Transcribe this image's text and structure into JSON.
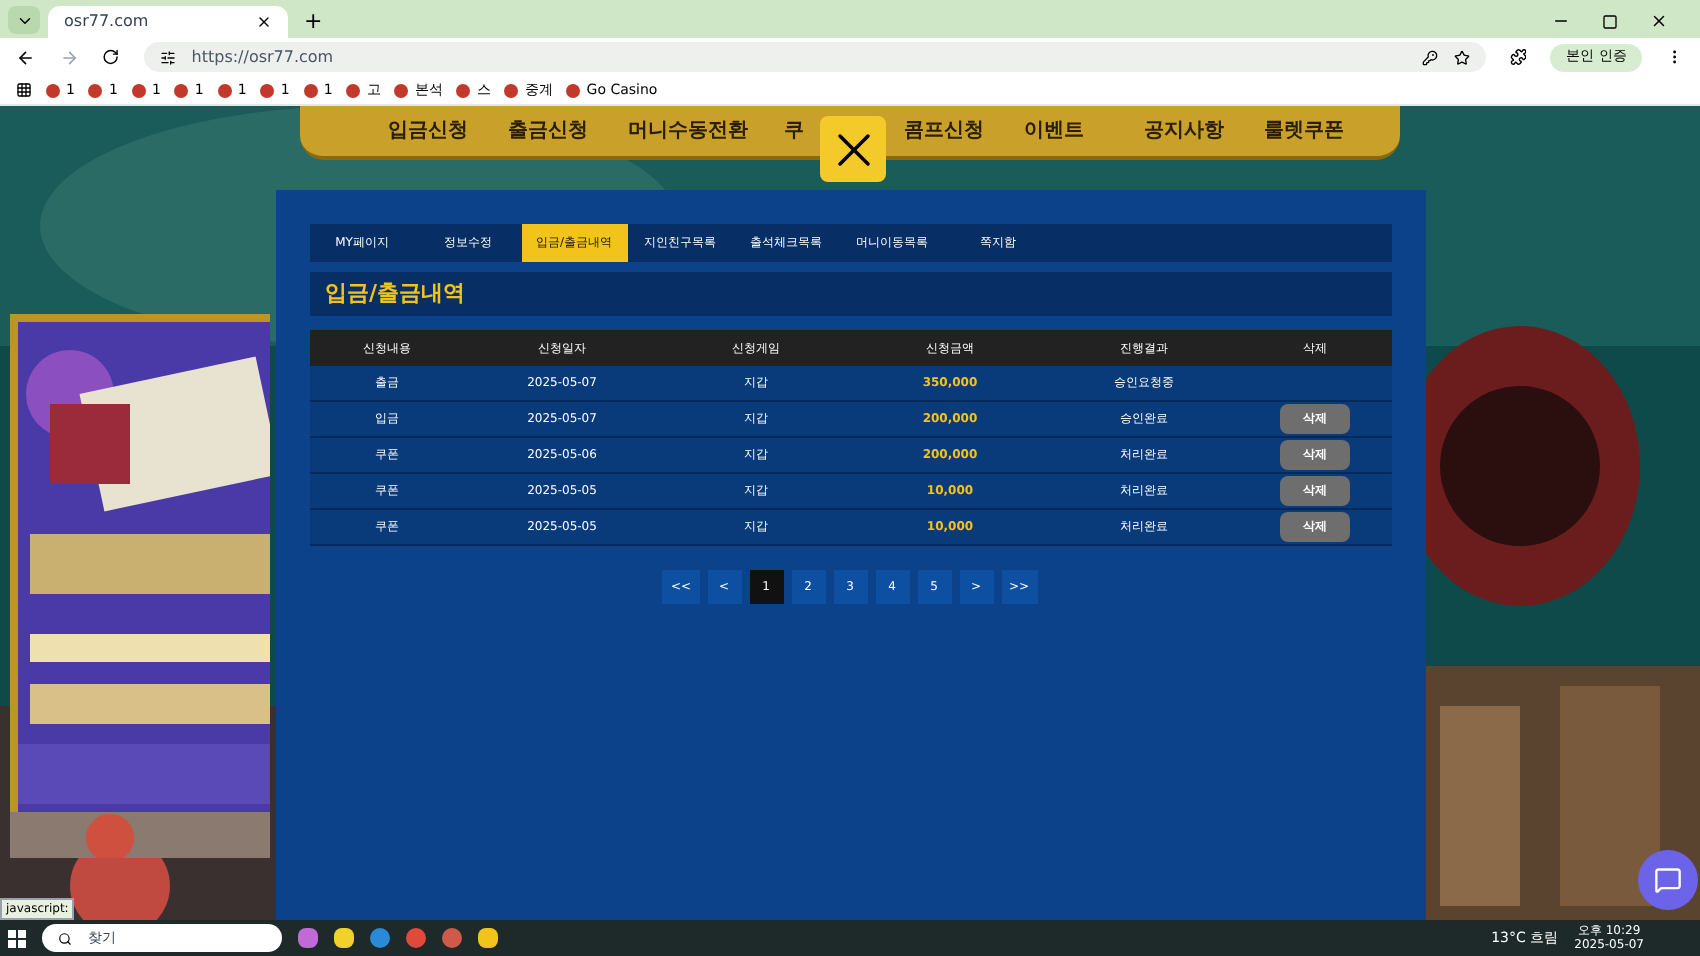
{
  "browser": {
    "tab_title": "osr77.com",
    "new_tab": "+",
    "url": "https://osr77.com",
    "profile_button": "본인 인증",
    "bookmarks": [
      "1",
      "1",
      "1",
      "1",
      "1",
      "1",
      "1",
      "고",
      "본석",
      "스",
      "중계",
      "Go Casino"
    ]
  },
  "nav": [
    "입금신청",
    "출금신청",
    "머니수동전환",
    "쿠",
    "콤프신청",
    "이벤트",
    "공지사항",
    "룰렛쿠폰"
  ],
  "tabs": [
    {
      "label": "MY페이지",
      "selected": false
    },
    {
      "label": "정보수정",
      "selected": false
    },
    {
      "label": "입금/출금내역",
      "selected": true
    },
    {
      "label": "지인친구목록",
      "selected": false
    },
    {
      "label": "출석체크목록",
      "selected": false
    },
    {
      "label": "머니이동목록",
      "selected": false
    },
    {
      "label": "쪽지함",
      "selected": false
    }
  ],
  "heading": "입금/출금내역",
  "table": {
    "columns": [
      "신청내용",
      "신청일자",
      "신청게임",
      "신청금액",
      "진행결과",
      "삭제"
    ],
    "rows": [
      {
        "cells": [
          "출금",
          "2025-05-07",
          "지갑",
          "350,000",
          "승인요청중"
        ]
      },
      {
        "cells": [
          "입금",
          "2025-05-07",
          "지갑",
          "200,000",
          "승인완료"
        ],
        "delete": "삭제"
      },
      {
        "cells": [
          "쿠폰",
          "2025-05-06",
          "지갑",
          "200,000",
          "처리완료"
        ],
        "delete": "삭제"
      },
      {
        "cells": [
          "쿠폰",
          "2025-05-05",
          "지갑",
          "10,000",
          "처리완료"
        ],
        "delete": "삭제"
      },
      {
        "cells": [
          "쿠폰",
          "2025-05-05",
          "지갑",
          "10,000",
          "처리완료"
        ],
        "delete": "삭제"
      }
    ]
  },
  "pagination": [
    {
      "label": "<<",
      "selected": false
    },
    {
      "label": "<",
      "selected": false
    },
    {
      "label": "1",
      "selected": true
    },
    {
      "label": "2",
      "selected": false
    },
    {
      "label": "3",
      "selected": false
    },
    {
      "label": "4",
      "selected": false
    },
    {
      "label": "5",
      "selected": false
    },
    {
      "label": ">",
      "selected": false
    },
    {
      "label": ">>",
      "selected": false
    }
  ],
  "status_url": "javascript:",
  "taskbar": {
    "search": "찾기",
    "weather": "13°C 흐림",
    "time": "오후 10:29",
    "date": "2025-05-07"
  }
}
